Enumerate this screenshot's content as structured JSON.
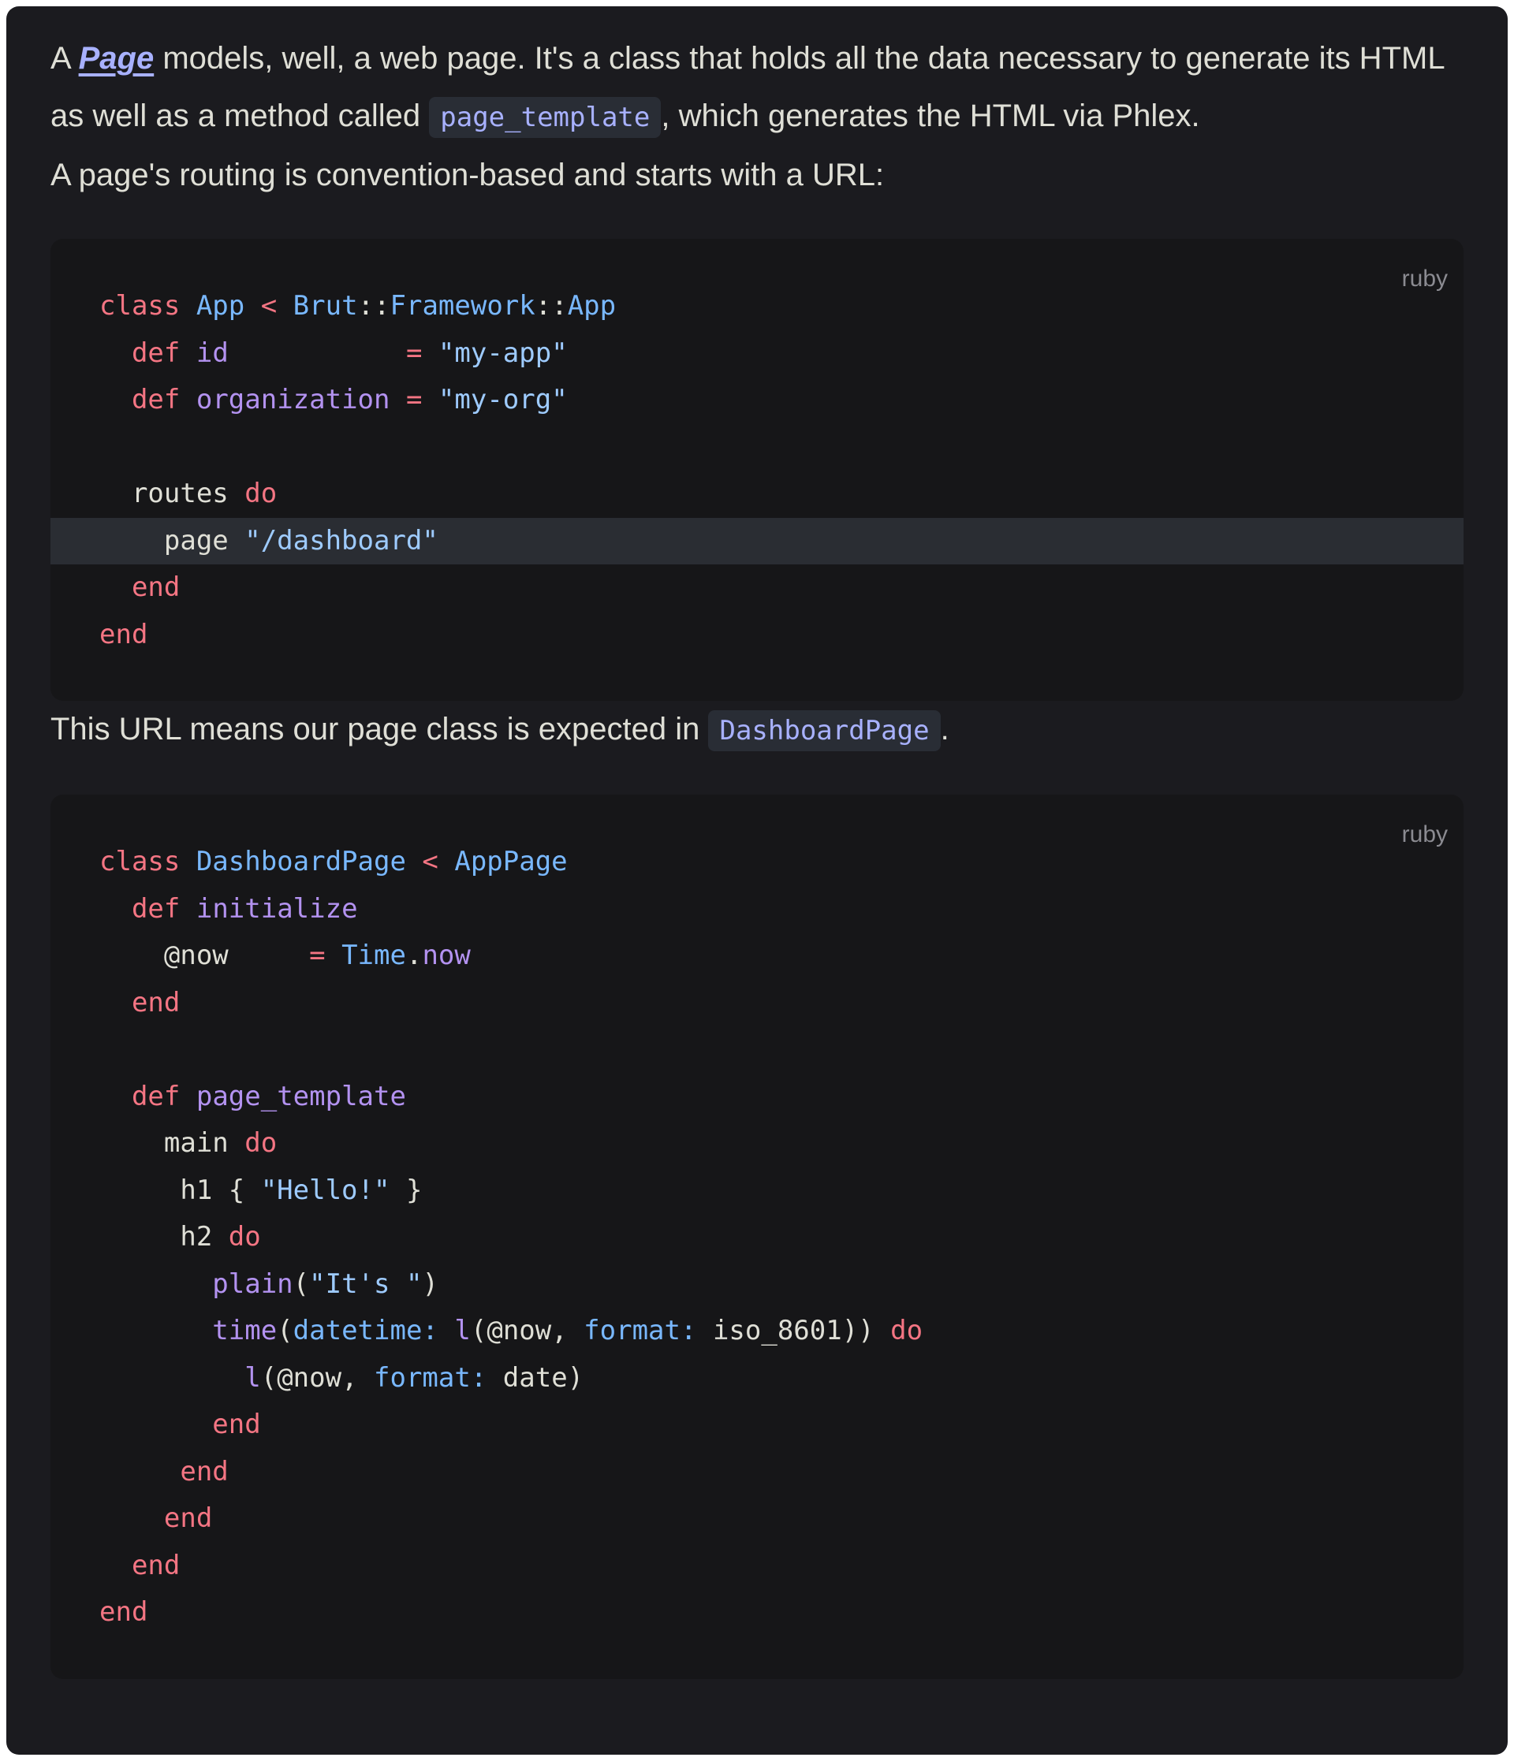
{
  "intro": {
    "p1_a": "A ",
    "p1_link": "Page",
    "p1_b": " models, well, a web page. It's a class that holds all the data necessary to generate its HTML as well as a method called ",
    "p1_code": "page_template",
    "p1_c": ", which generates the HTML via Phlex.",
    "p2": "A page's routing is convention-based and starts with a URL:",
    "p3_a": "This URL means our page class is expected in ",
    "p3_code": "DashboardPage",
    "p3_b": "."
  },
  "code_blocks": [
    {
      "language": "ruby",
      "highlighted_line_index": 5,
      "lines": [
        [
          [
            "kw",
            "class "
          ],
          [
            "cn",
            "App"
          ],
          [
            "kw",
            " < "
          ],
          [
            "cn",
            "Brut"
          ],
          [
            "pl",
            "::"
          ],
          [
            "cn",
            "Framework"
          ],
          [
            "pl",
            "::"
          ],
          [
            "cn",
            "App"
          ]
        ],
        [
          [
            "pl",
            "  "
          ],
          [
            "kw",
            "def "
          ],
          [
            "fn",
            "id"
          ],
          [
            "pl",
            "           "
          ],
          [
            "kw",
            "= "
          ],
          [
            "st",
            "\"my-app\""
          ]
        ],
        [
          [
            "pl",
            "  "
          ],
          [
            "kw",
            "def "
          ],
          [
            "fn",
            "organization"
          ],
          [
            "pl",
            " "
          ],
          [
            "kw",
            "= "
          ],
          [
            "st",
            "\"my-org\""
          ]
        ],
        [
          [
            "pl",
            ""
          ]
        ],
        [
          [
            "pl",
            "  routes "
          ],
          [
            "kw",
            "do"
          ]
        ],
        [
          [
            "pl",
            "    page "
          ],
          [
            "st",
            "\"/dashboard\""
          ]
        ],
        [
          [
            "pl",
            "  "
          ],
          [
            "kw",
            "end"
          ]
        ],
        [
          [
            "kw",
            "end"
          ]
        ]
      ]
    },
    {
      "language": "ruby",
      "highlighted_line_index": -1,
      "lines": [
        [
          [
            "kw",
            "class "
          ],
          [
            "cn",
            "DashboardPage"
          ],
          [
            "kw",
            " < "
          ],
          [
            "cn",
            "AppPage"
          ]
        ],
        [
          [
            "pl",
            "  "
          ],
          [
            "kw",
            "def "
          ],
          [
            "fn",
            "initialize"
          ]
        ],
        [
          [
            "pl",
            "    @now     "
          ],
          [
            "kw",
            "= "
          ],
          [
            "cn",
            "Time"
          ],
          [
            "pl",
            "."
          ],
          [
            "fn",
            "now"
          ]
        ],
        [
          [
            "pl",
            "  "
          ],
          [
            "kw",
            "end"
          ]
        ],
        [
          [
            "pl",
            ""
          ]
        ],
        [
          [
            "pl",
            "  "
          ],
          [
            "kw",
            "def "
          ],
          [
            "fn",
            "page_template"
          ]
        ],
        [
          [
            "pl",
            "    main "
          ],
          [
            "kw",
            "do"
          ]
        ],
        [
          [
            "pl",
            "     h1 { "
          ],
          [
            "st",
            "\"Hello!\""
          ],
          [
            "pl",
            " }"
          ]
        ],
        [
          [
            "pl",
            "     h2 "
          ],
          [
            "kw",
            "do"
          ]
        ],
        [
          [
            "pl",
            "       "
          ],
          [
            "fn",
            "plain"
          ],
          [
            "pl",
            "("
          ],
          [
            "st",
            "\"It's \""
          ],
          [
            "pl",
            ")"
          ]
        ],
        [
          [
            "pl",
            "       "
          ],
          [
            "fn",
            "time"
          ],
          [
            "pl",
            "("
          ],
          [
            "cn",
            "datetime:"
          ],
          [
            "pl",
            " "
          ],
          [
            "fn",
            "l"
          ],
          [
            "pl",
            "(@now, "
          ],
          [
            "cn",
            "format:"
          ],
          [
            "pl",
            " iso_8601)) "
          ],
          [
            "kw",
            "do"
          ]
        ],
        [
          [
            "pl",
            "         "
          ],
          [
            "fn",
            "l"
          ],
          [
            "pl",
            "(@now, "
          ],
          [
            "cn",
            "format:"
          ],
          [
            "pl",
            " date)"
          ]
        ],
        [
          [
            "pl",
            "       "
          ],
          [
            "kw",
            "end"
          ]
        ],
        [
          [
            "pl",
            "     "
          ],
          [
            "kw",
            "end"
          ]
        ],
        [
          [
            "pl",
            "    "
          ],
          [
            "kw",
            "end"
          ]
        ],
        [
          [
            "pl",
            "  "
          ],
          [
            "kw",
            "end"
          ]
        ],
        [
          [
            "kw",
            "end"
          ]
        ]
      ]
    }
  ]
}
